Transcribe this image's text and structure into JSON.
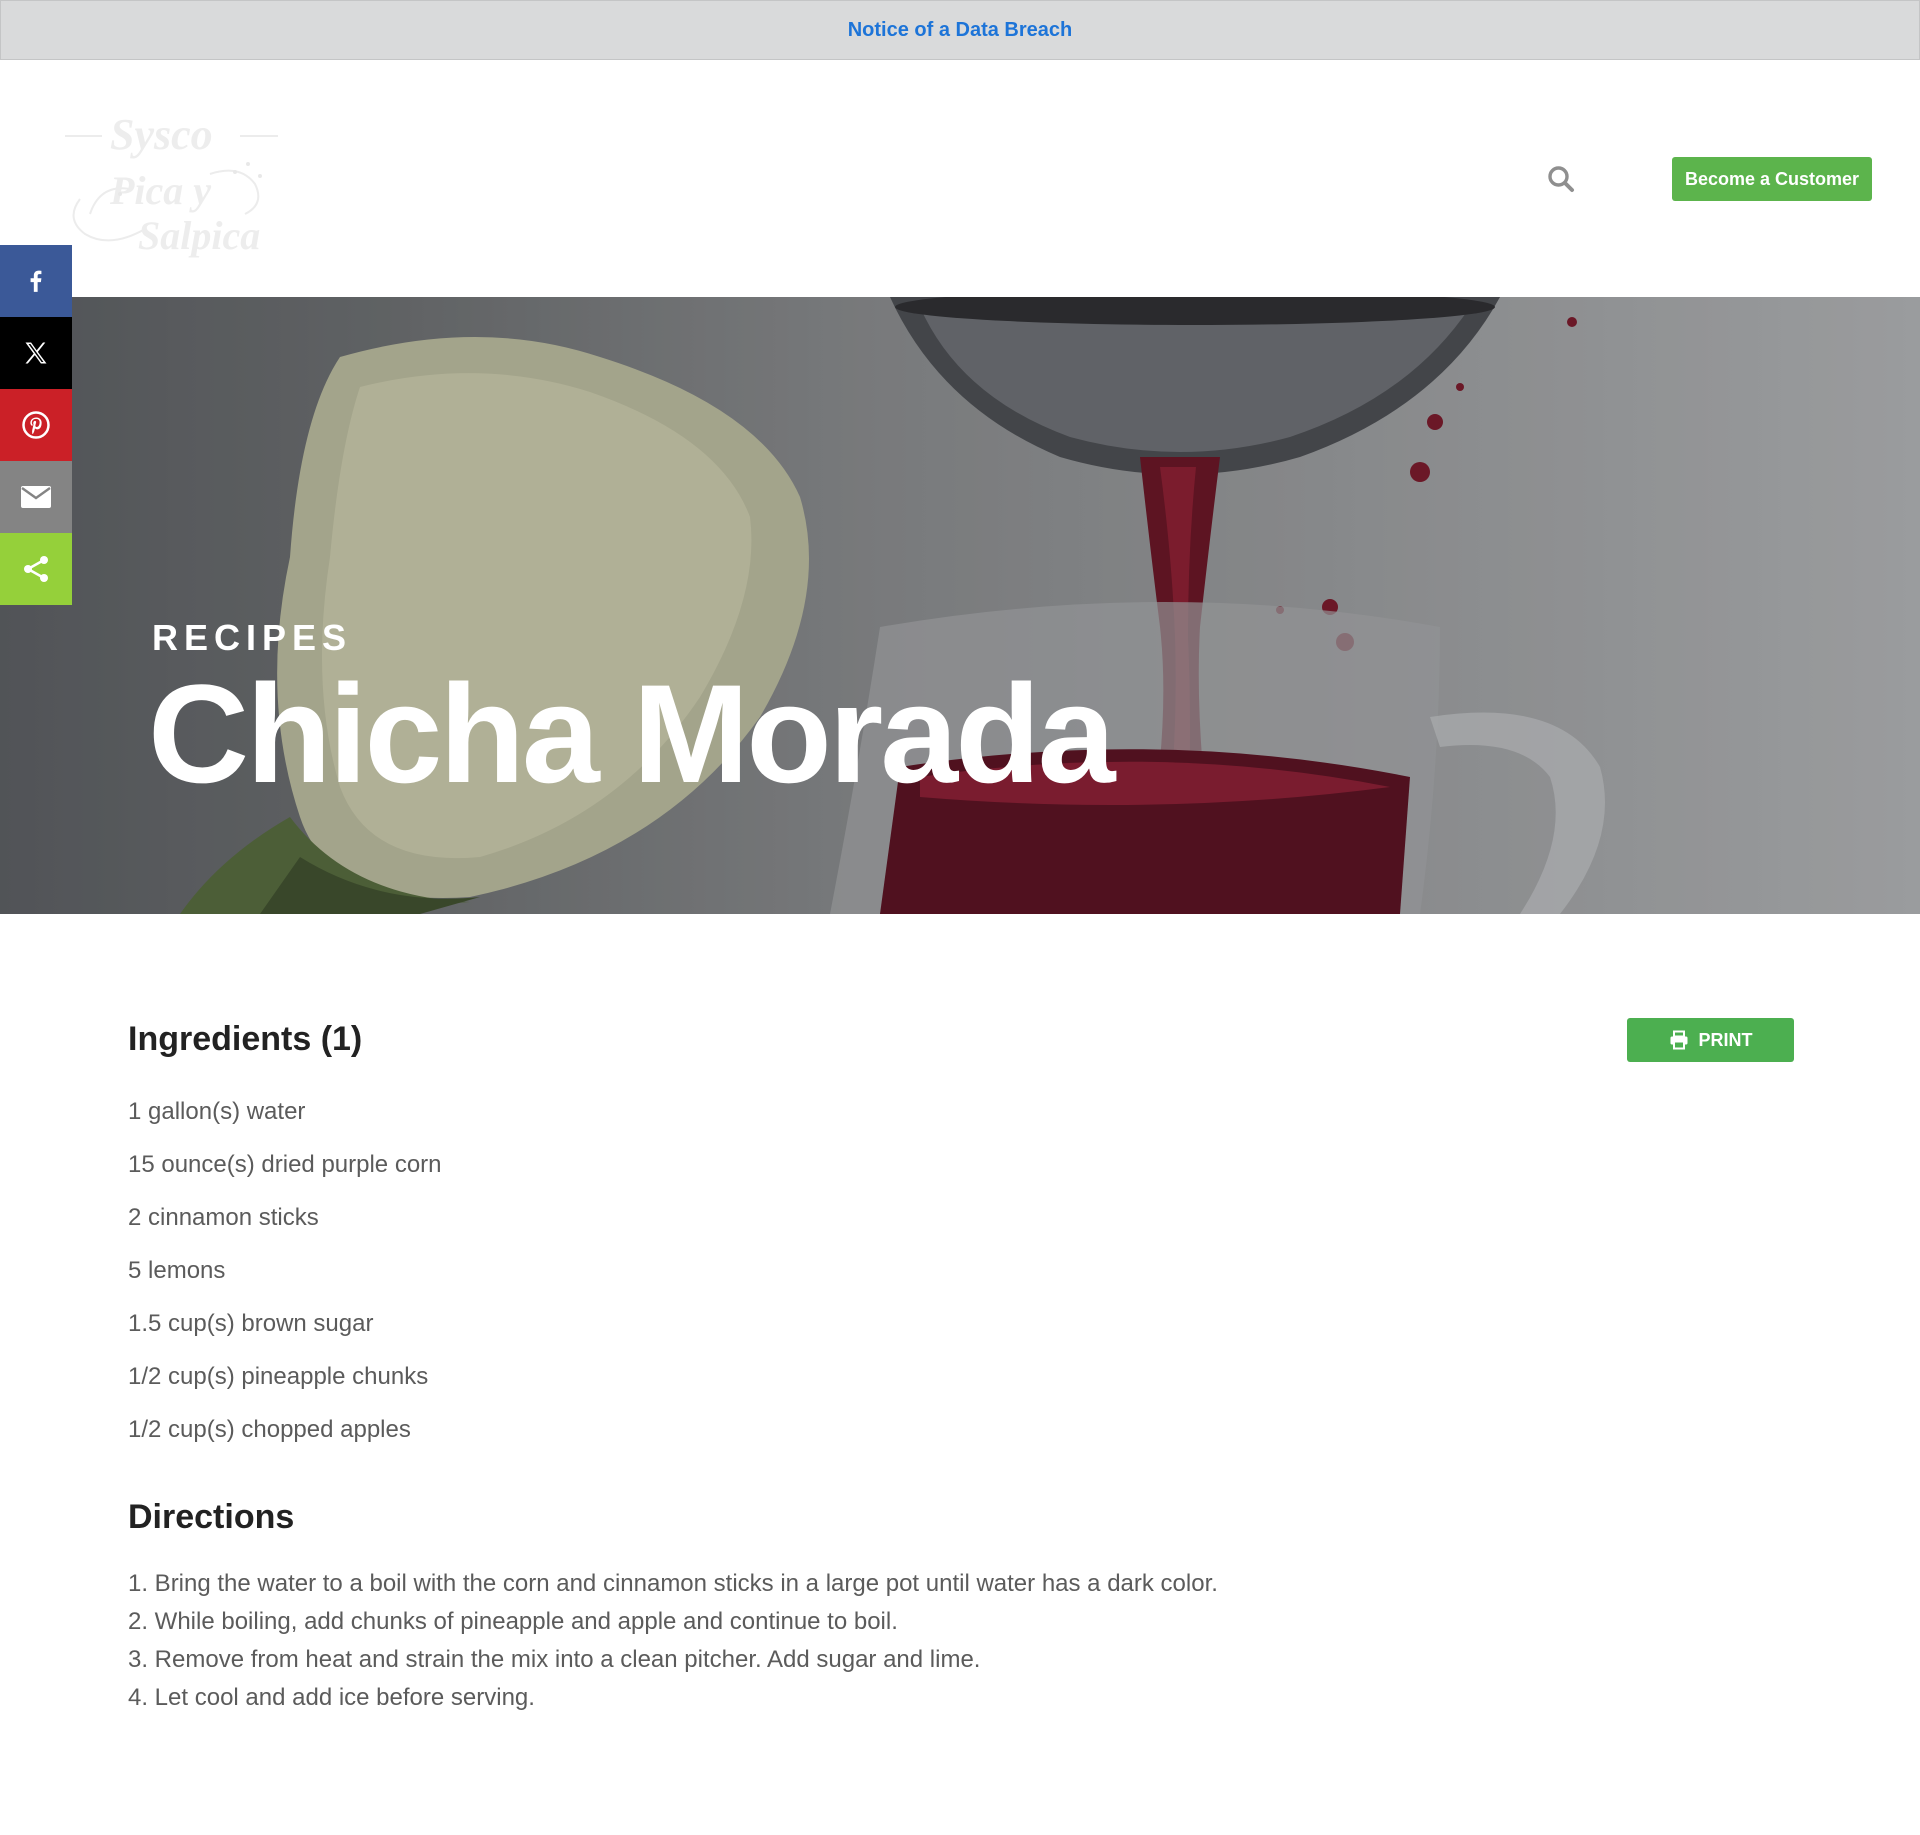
{
  "notice": {
    "link_text": "Notice of a Data Breach"
  },
  "header": {
    "logo": {
      "alt": "Sysco Pica y Salpica",
      "line1": "Sysco",
      "line2": "Pica y",
      "line3": "Salpica"
    },
    "search_icon": "search-icon",
    "become_customer_label": "Become a Customer"
  },
  "share": {
    "items": [
      {
        "name": "facebook",
        "icon": "facebook-icon",
        "color": "#3b5998"
      },
      {
        "name": "x",
        "icon": "x-icon",
        "color": "#000000"
      },
      {
        "name": "pinterest",
        "icon": "pinterest-icon",
        "color": "#cb2027"
      },
      {
        "name": "email",
        "icon": "email-icon",
        "color": "#848484"
      },
      {
        "name": "share",
        "icon": "share-icon",
        "color": "#95d03a"
      }
    ]
  },
  "hero": {
    "eyebrow": "RECIPES",
    "title": "Chicha Morada"
  },
  "recipe": {
    "ingredients_title": "Ingredients (1)",
    "print_label": "PRINT",
    "ingredients": [
      "1 gallon(s) water",
      "15 ounce(s) dried purple corn",
      "2 cinnamon sticks",
      "5 lemons",
      "1.5 cup(s) brown sugar",
      "1/2 cup(s) pineapple chunks",
      "1/2 cup(s) chopped apples"
    ],
    "directions_title": "Directions",
    "directions": [
      "1. Bring the water to a boil with the corn and cinnamon sticks in a large pot until water has a dark color.",
      "2. While boiling, add chunks of pineapple and apple and continue to boil.",
      "3. Remove from heat and strain the mix into a clean pitcher. Add sugar and lime.",
      "4. Let cool and add ice before serving."
    ]
  },
  "colors": {
    "accent_green": "#5cb44c",
    "notice_link": "#1d74d8"
  }
}
